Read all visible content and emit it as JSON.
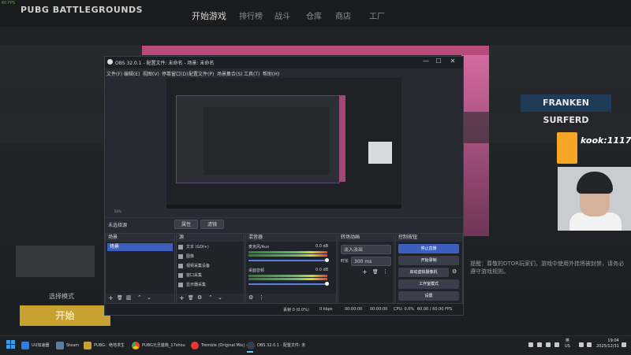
{
  "game": {
    "fps_overlay": "60 FPS",
    "logo": "PUBG BATTLEGROUNDS",
    "nav": [
      "开始游戏",
      "排行榜",
      "战斗",
      "仓库",
      "商店",
      "工厂"
    ],
    "mode_label": "选择模式",
    "play_button": "开始",
    "banner": "FRANKEN SURFERD",
    "kook": "kook:1117",
    "chat_text": "提醒：尊敬的DTOR玩家们，游戏中使用外挂将被封禁，请务必遵守游戏规则。"
  },
  "obs": {
    "title": "OBS 32.0.1 - 配置文件: 未命名 - 场景: 未命名",
    "window_controls": {
      "minimize": "—",
      "maximize": "☐",
      "close": "✕"
    },
    "menu": [
      "文件(F)",
      "编辑(E)",
      "视图(V)",
      "停靠窗口(D)",
      "配置文件(P)",
      "场景集合(S)",
      "工具(T)",
      "帮助(H)"
    ],
    "toolbar_fps": "50%",
    "scene_bar": {
      "label": "未选择源",
      "props": "属性",
      "filters": "滤镜"
    },
    "docks": {
      "scenes": {
        "title": "场景",
        "items": [
          "场景"
        ]
      },
      "sources": {
        "title": "源",
        "items": [
          {
            "name": "文本 (GDI+)",
            "icon": "text-icon"
          },
          {
            "name": "图像",
            "icon": "image-icon"
          },
          {
            "name": "视频采集设备",
            "icon": "camera-icon"
          },
          {
            "name": "窗口采集",
            "icon": "window-icon"
          },
          {
            "name": "显示器采集",
            "icon": "monitor-icon"
          }
        ]
      },
      "mixer": {
        "title": "混音器",
        "channels": [
          {
            "name": "麦克风/Aux",
            "level": "0.0 dB"
          },
          {
            "name": "桌面音频",
            "level": "0.0 dB"
          }
        ]
      },
      "transitions": {
        "title": "转场动画",
        "type": "淡入淡出",
        "duration_label": "时长",
        "duration": "300 ms"
      },
      "controls": {
        "title": "控制按钮",
        "buttons": [
          "停止直播",
          "开始录制",
          "启动虚拟摄像机",
          "工作室模式",
          "设置"
        ]
      }
    },
    "status": {
      "frames": "丢帧 0 (0.0%)",
      "kbps": "0 kbps",
      "stream_time": "00:00:00",
      "rec_time": "00:00:00",
      "cpu": "CPU: 0.0%",
      "fps": "60.00 / 60.00 FPS"
    }
  },
  "taskbar": {
    "apps": [
      {
        "label": "UU加速器",
        "color": "#2f7de1"
      },
      {
        "label": "Steam",
        "color": "#1b2838"
      },
      {
        "label": "PUBG：绝地求生",
        "color": "#c8a231"
      },
      {
        "label": "PUBG元旦盛典_17shou",
        "color": "#e8eaed"
      },
      {
        "label": "Tremble (Original Mix) -",
        "color": "#e53935"
      },
      {
        "label": "OBS 32.0.1 - 配置文件: 未",
        "color": "#3a3e4a"
      }
    ],
    "ime_top": "英",
    "ime_bottom": "US",
    "time": "19:04",
    "date": "2025/12/31"
  }
}
